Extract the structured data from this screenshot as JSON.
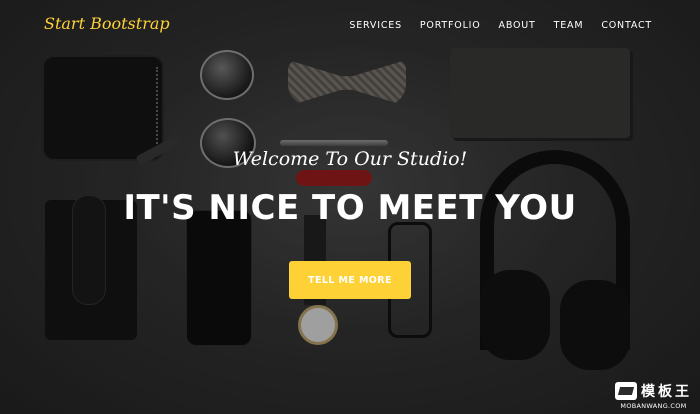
{
  "nav": {
    "brand": "Start Bootstrap",
    "items": [
      {
        "label": "SERVICES"
      },
      {
        "label": "PORTFOLIO"
      },
      {
        "label": "ABOUT"
      },
      {
        "label": "TEAM"
      },
      {
        "label": "CONTACT"
      }
    ]
  },
  "hero": {
    "lead": "Welcome To Our Studio!",
    "heading": "IT'S NICE TO MEET YOU",
    "button_label": "TELL ME MORE"
  },
  "watermark": {
    "name": "模板王",
    "url": "MOBANWANG.COM"
  },
  "colors": {
    "accent": "#fed136",
    "text": "#ffffff"
  }
}
